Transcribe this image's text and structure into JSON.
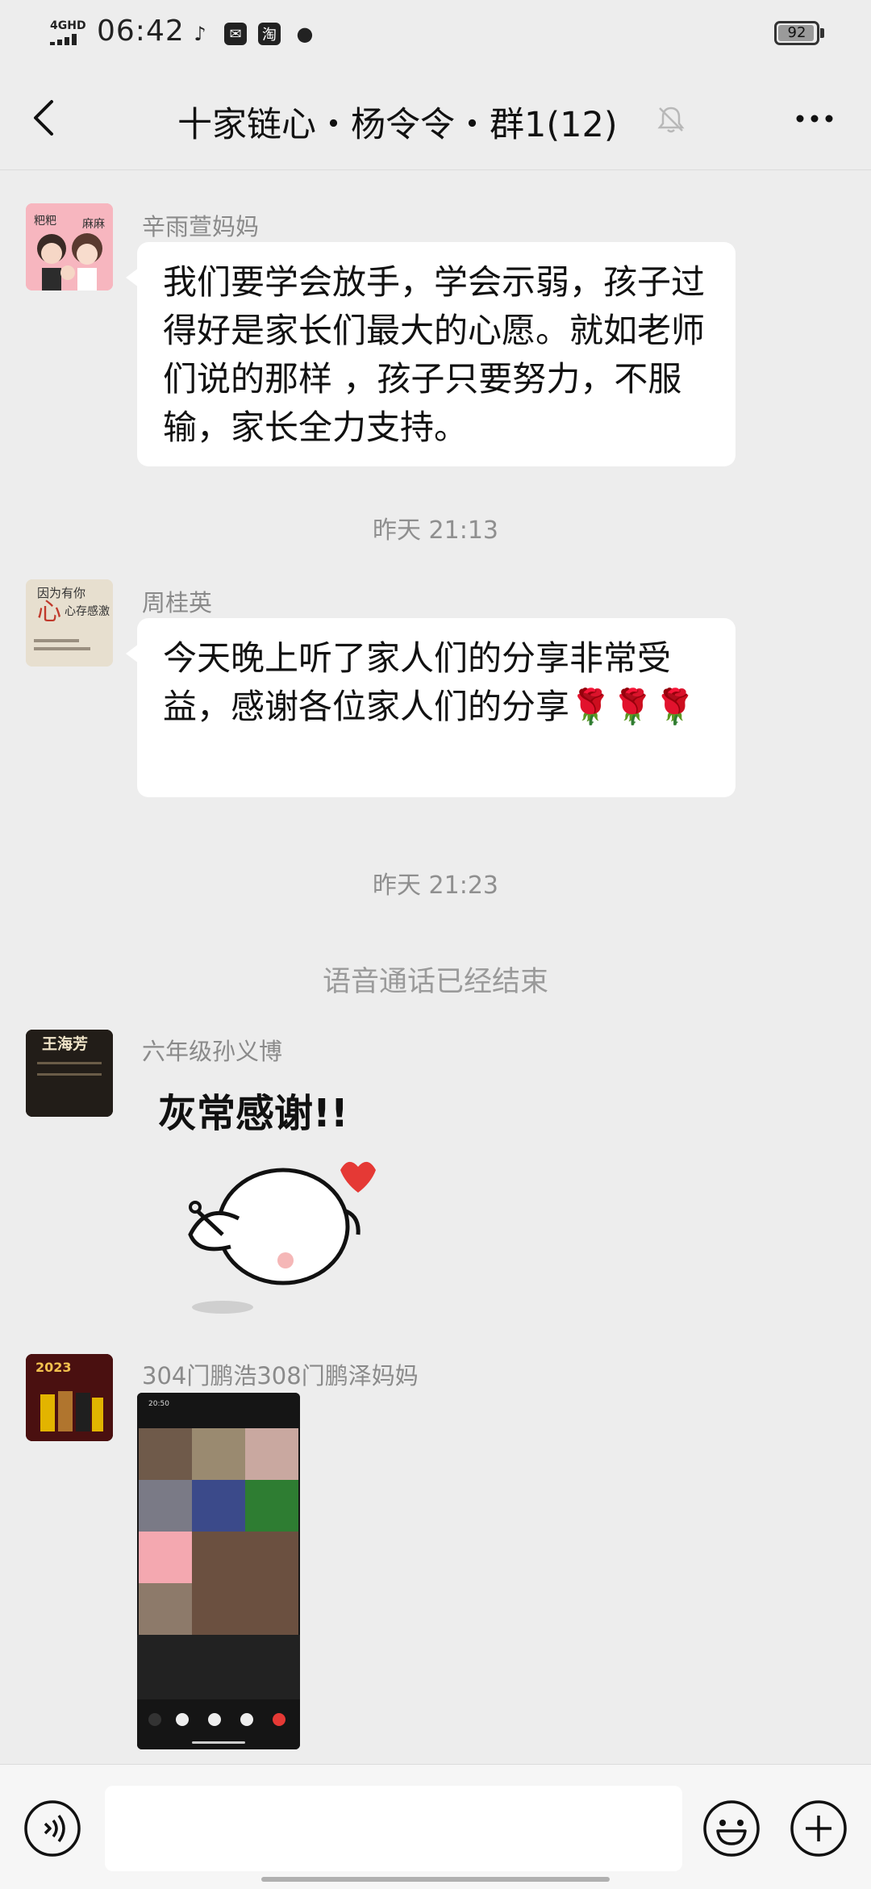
{
  "status_bar": {
    "network": "4GHD",
    "time": "06:42",
    "icons": [
      "tiktok-icon",
      "mail-icon",
      "taobao-icon",
      "chat-icon"
    ],
    "taobao_label": "淘",
    "battery": "92"
  },
  "header": {
    "title": "十家链心・杨令令・群1(12)",
    "muted": true
  },
  "messages": [
    {
      "sender": "辛雨萱妈妈",
      "text": "我们要学会放手，学会示弱，孩子过得好是家长们最大的心愿。就如老师们说的那样 ，孩子只要努力，不服输，家长全力支持。"
    },
    {
      "timestamp": "昨天 21:13"
    },
    {
      "sender": "周桂英",
      "text": "今天晚上听了家人们的分享非常受益，感谢各位家人们的分享🌹🌹🌹"
    },
    {
      "timestamp": "昨天 21:23"
    },
    {
      "system": "语音通话已经结束"
    },
    {
      "sender": "六年级孙义博",
      "sticker_text": "灰常感谢!!"
    },
    {
      "sender": "304门鹏浩308门鹏泽妈妈",
      "image": "screenshot",
      "image_time": "20:50"
    }
  ],
  "avatars": {
    "a1_text_left": "粑粑",
    "a1_text_right": "麻麻",
    "a2_title": "因为有你",
    "a2_sub": "心存感激",
    "a3_name": "王海芳",
    "a4_year": "2023"
  },
  "colors": {
    "bg": "#ededed",
    "bubble": "#ffffff",
    "meta_text": "#8a8a8a"
  }
}
